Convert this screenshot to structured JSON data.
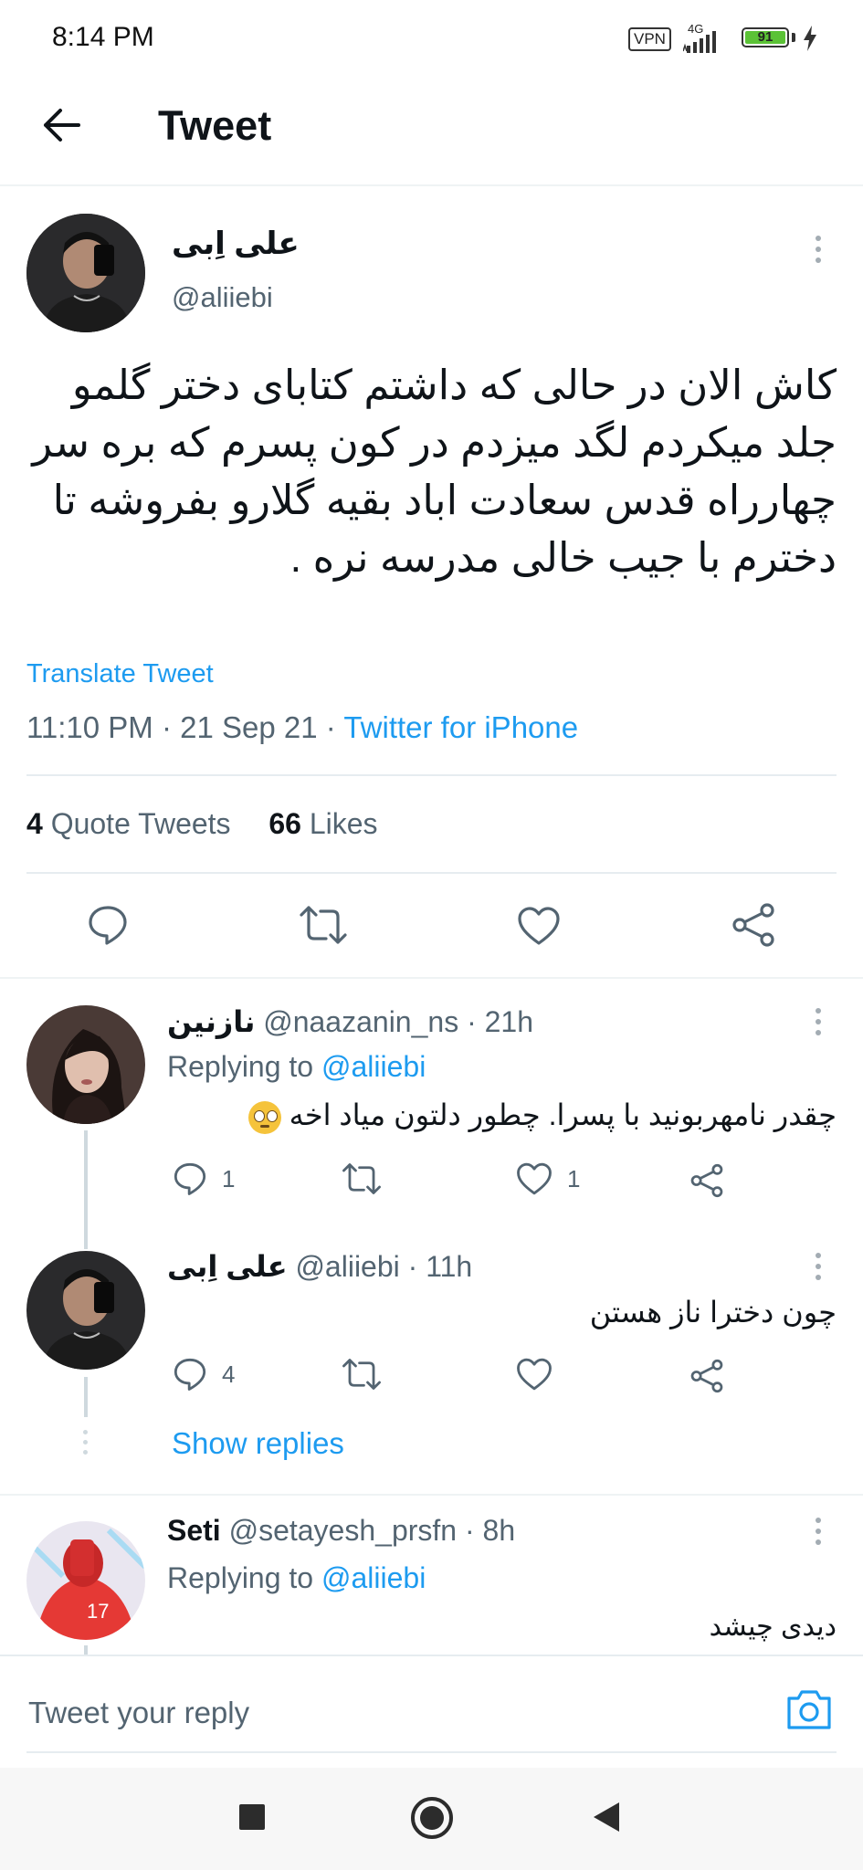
{
  "status_bar": {
    "time": "8:14 PM",
    "vpn": "VPN",
    "network": "4G",
    "battery": "91"
  },
  "header": {
    "title": "Tweet"
  },
  "tweet": {
    "name": "علی اِبی",
    "handle": "@aliiebi",
    "text": "کاش الان در حالی که داشتم کتابای دختر گلمو جلد میکردم لگد میزدم در کون پسرم که بره سر چهارراه قدس سعادت اباد بقیه گلارو بفروشه تا دخترم با جیب خالی مدرسه نره .",
    "translate": "Translate Tweet",
    "time": "11:10 PM · 21 Sep 21 · ",
    "source": "Twitter for iPhone",
    "quote_count": "4",
    "quote_label": "Quote Tweets",
    "like_count": "66",
    "like_label": "Likes"
  },
  "replies": [
    {
      "name": "نازنین",
      "handle": "@naazanin_ns",
      "age": "· 21h",
      "replying_prefix": "Replying to ",
      "replying_to": "@aliiebi",
      "text": "چقدر نامهربونید با پسرا. چطور دلتون میاد اخه",
      "emoji": "🥺",
      "reply_count": "1",
      "retweet_count": "",
      "like_count": "1"
    },
    {
      "name": "علی اِبی",
      "handle": "@aliiebi",
      "age": "· 11h",
      "text": "چون دخترا ناز هستن",
      "reply_count": "4",
      "retweet_count": "",
      "like_count": "",
      "show_replies": "Show replies"
    },
    {
      "name": "Seti",
      "handle": "@setayesh_prsfn",
      "age": "· 8h",
      "replying_prefix": "Replying to ",
      "replying_to": "@aliiebi",
      "text": "دیدی چیشد"
    }
  ],
  "composer": {
    "placeholder": "Tweet your reply"
  },
  "colors": {
    "accent": "#1d9bf0",
    "text": "#0f1419",
    "muted": "#536471",
    "divider": "#eff3f4"
  }
}
